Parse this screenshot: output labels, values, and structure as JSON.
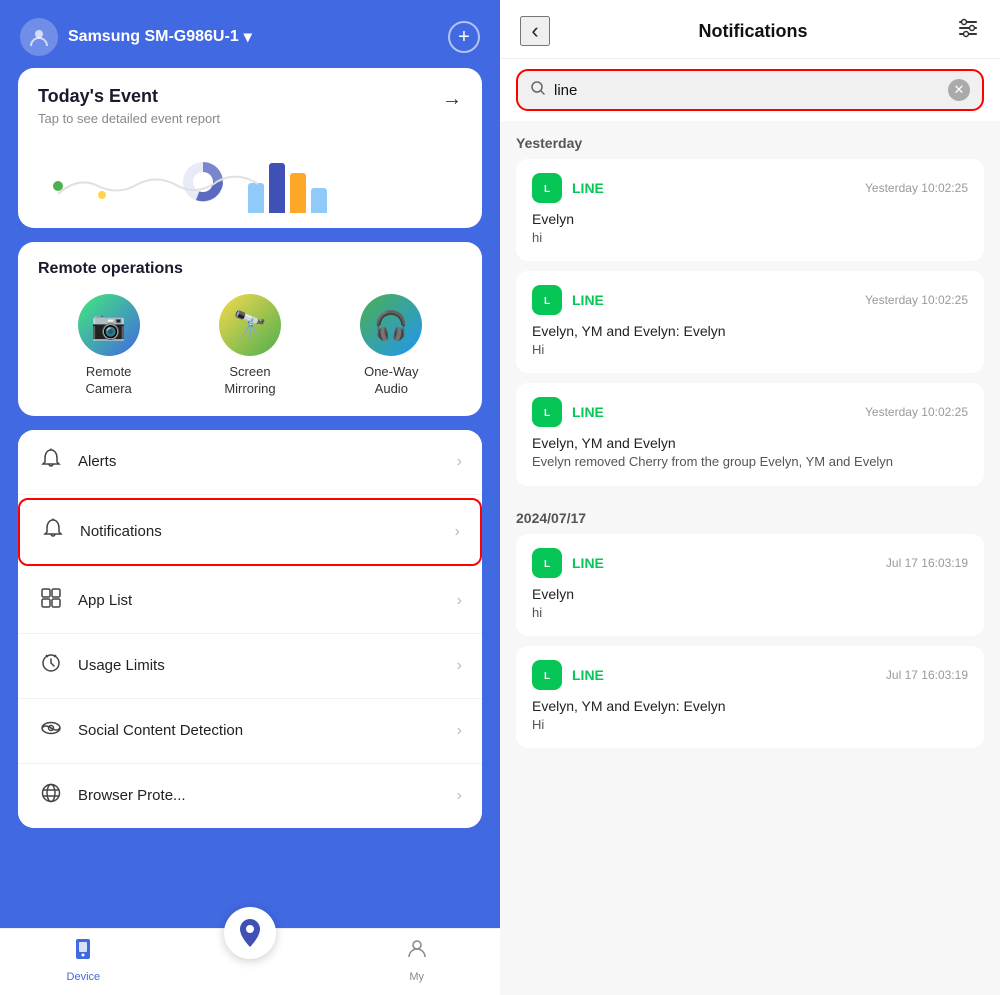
{
  "left": {
    "header": {
      "device_name": "Samsung SM-G986U-1",
      "dropdown_icon": "▾",
      "add_label": "+"
    },
    "event_card": {
      "title": "Today's Event",
      "subtitle": "Tap to see detailed event report",
      "arrow": "→"
    },
    "remote_ops": {
      "title": "Remote operations",
      "items": [
        {
          "label": "Remote\nCamera",
          "icon": "📷"
        },
        {
          "label": "Screen\nMirroring",
          "icon": "🔭"
        },
        {
          "label": "One-Way\nAudio",
          "icon": "🎧"
        }
      ]
    },
    "menu": [
      {
        "id": "alerts",
        "label": "Alerts",
        "icon": "🔔"
      },
      {
        "id": "notifications",
        "label": "Notifications",
        "icon": "🔔",
        "active": true
      },
      {
        "id": "app-list",
        "label": "App List",
        "icon": "⊞"
      },
      {
        "id": "usage-limits",
        "label": "Usage Limits",
        "icon": "⏱"
      },
      {
        "id": "social-content",
        "label": "Social Content Detection",
        "icon": "👁"
      },
      {
        "id": "browser-prote",
        "label": "Browser Prote...",
        "icon": "🌐"
      }
    ],
    "bottom_tabs": [
      {
        "id": "device",
        "label": "Device",
        "icon": "📱",
        "active": true
      },
      {
        "id": "location",
        "label": "",
        "icon": "📍",
        "fab": true
      },
      {
        "id": "my",
        "label": "My",
        "icon": "👤",
        "active": false
      }
    ]
  },
  "right": {
    "header": {
      "back_icon": "‹",
      "title": "Notifications",
      "filter_icon": "⊞"
    },
    "search": {
      "placeholder": "line",
      "value": "line",
      "clear_icon": "✕"
    },
    "sections": [
      {
        "date": "Yesterday",
        "notifications": [
          {
            "app": "LINE",
            "time": "Yesterday 10:02:25",
            "title": "Evelyn",
            "body": "hi"
          },
          {
            "app": "LINE",
            "time": "Yesterday 10:02:25",
            "title": "Evelyn, YM and Evelyn: Evelyn",
            "body": "Hi"
          },
          {
            "app": "LINE",
            "time": "Yesterday 10:02:25",
            "title": "Evelyn, YM and Evelyn",
            "body": "Evelyn removed Cherry from the group Evelyn, YM and Evelyn"
          }
        ]
      },
      {
        "date": "2024/07/17",
        "notifications": [
          {
            "app": "LINE",
            "time": "Jul 17 16:03:19",
            "title": "Evelyn",
            "body": "hi"
          },
          {
            "app": "LINE",
            "time": "Jul 17 16:03:19",
            "title": "Evelyn, YM and Evelyn: Evelyn",
            "body": "Hi"
          }
        ]
      }
    ]
  }
}
